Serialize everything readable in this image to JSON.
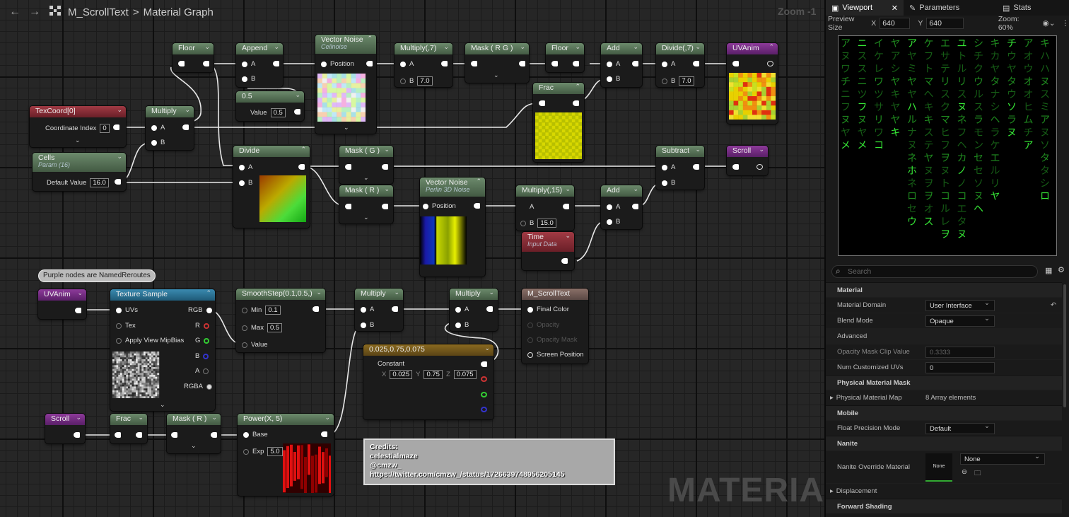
{
  "topbar": {
    "back": "←",
    "forward": "→",
    "asset": "M_ScrollText",
    "sep": ">",
    "title": "Material Graph",
    "zoom": "Zoom -1"
  },
  "comment": "Purple nodes are NamedReroutes",
  "credits": [
    "Credits:",
    "celestialmaze",
    "@cmzw_",
    "https://twitter.com/cmzw_/status/1726639748956205145"
  ],
  "watermark": "MATERIAL",
  "nodes": {
    "floor1": "Floor",
    "append": "Append",
    "vnoise1": "Vector Noise",
    "vnoise1_sub": "Cellnoise",
    "position": "Position",
    "mult7": "Multiply(,7)",
    "maskrg": "Mask ( R G )",
    "floor2": "Floor",
    "add1": "Add",
    "divide7": "Divide(,7)",
    "uvanim": "UVAnim",
    "half": "0.5",
    "value": "Value",
    "half_val": "0.5",
    "texcoord": "TexCoord[0]",
    "coord_index": "Coordinate Index",
    "coord_val": "0",
    "multiply1": "Multiply",
    "frac1": "Frac",
    "cells": "Cells",
    "cells_sub": "Param (16)",
    "default_value": "Default Value",
    "cells_val": "16.0",
    "divide": "Divide",
    "maskg": "Mask ( G )",
    "maskr": "Mask ( R )",
    "vnoise2": "Vector Noise",
    "vnoise2_sub": "Perlin 3D Noise",
    "mult15": "Multiply(,15)",
    "b15": "15.0",
    "add2": "Add",
    "time": "Time",
    "time_sub": "Input Data",
    "subtract": "Subtract",
    "scroll": "Scroll",
    "pin_a": "A",
    "pin_b": "B",
    "b7": "7.0",
    "uvanim2": "UVAnim",
    "texsample": "Texture Sample",
    "uvs": "UVs",
    "tex": "Tex",
    "mipbias": "Apply View MipBias",
    "rgb": "RGB",
    "r": "R",
    "g": "G",
    "b": "B",
    "a": "A",
    "rgba": "RGBA",
    "smooth": "SmoothStep(0.1,0.5,)",
    "min": "Min",
    "min_val": "0.1",
    "max": "Max",
    "max_val": "0.5",
    "multiply2": "Multiply",
    "multiply3": "Multiply",
    "result": "M_ScrollText",
    "final_color": "Final Color",
    "opacity": "Opacity",
    "opacity_mask": "Opacity Mask",
    "screen_pos": "Screen Position",
    "const3": "0.025,0.75,0.075",
    "constant": "Constant",
    "cx": "X",
    "cx_val": "0.025",
    "cy": "Y",
    "cy_val": "0.75",
    "cz": "Z",
    "cz_val": "0.075",
    "scroll2": "Scroll",
    "frac2": "Frac",
    "maskr2": "Mask ( R )",
    "power": "Power(X, 5)",
    "base": "Base",
    "exp": "Exp",
    "exp_val": "5.0"
  },
  "panel": {
    "tabs": [
      "Viewport",
      "Parameters",
      "Stats"
    ],
    "preview_size": "Preview Size",
    "x": "X",
    "x_val": "640",
    "y": "Y",
    "y_val": "640",
    "zoom": "Zoom: 60%",
    "search": "Search",
    "sections": {
      "material": "Material",
      "advanced": "Advanced",
      "phys": "Physical Material Mask",
      "mobile": "Mobile",
      "nanite": "Nanite",
      "forward": "Forward Shading"
    },
    "rows": {
      "domain": "Material Domain",
      "domain_val": "User Interface",
      "blend": "Blend Mode",
      "blend_val": "Opaque",
      "clip": "Opacity Mask Clip Value",
      "clip_val": "0.3333",
      "uvs": "Num Customized UVs",
      "uvs_val": "0",
      "physmap": "Physical Material Map",
      "physmap_val": "8 Array elements",
      "float": "Float Precision Mode",
      "float_val": "Default",
      "nanite_mat": "Nanite Override Material",
      "none_thumb": "None",
      "none_dd": "None",
      "displacement": "Displacement"
    }
  },
  "matrix": {
    "cols": [
      "ア\nヌ\nワ\nチ\nニ\nフ\nヌ\nヤ\nメ",
      "ニ\nス\nス\nニ\nツ\nフ\nヌ\nヤ\nメ",
      "イ\nケ\nレ\nワ\nツ\nサ\nリ\nワ\nコ",
      "ヤ\nア\nシ\nヤ\nキ\nヤ\nヤ\nキ",
      "ア\nヤ\nミ\nヤ\nヤ\nハ\nル\nナ\nヌ\nネ\nホ\nネ\nロ\nセ\nウ",
      "ケ\nフ\nト\nマ\nヘ\nキ\nキ\nス\nテ\nヤ\nヌ\nヲ\nヲ\nオ\nス",
      "エ\nサ\nテ\nリ\nス\nク\nマ\nヒ\nフ\nヲ\nヌ\nト\nコ\nル\nレ\nヲ",
      "ユ\nト\nル\nリ\nス\nヌ\nネ\nフ\nヘ\nカ\nノ\nノ\nコ\nエ\nタ\nヌ",
      "シ\nチ\nク\nウ\nル\nス\nラ\nモ\nン\nセ\nセ\nソ\nヌ\nヘ",
      "キ\nカ\nヤ\nタ\nナ\nシ\nヘ\nラ\nケ\nエ\nル\nリ\nヤ",
      "チ\nウ\nヤ\nタ\nウ\nソ\nラ\nヌ",
      "ア\nオ\nウ\nオ\nオ\nヒ\nム\nチ\nア",
      "キ\nハ\nハ\nヌ\nス\nミ\nア\nヌ\nソ\nタ\nタ\nシ\nロ"
    ]
  }
}
